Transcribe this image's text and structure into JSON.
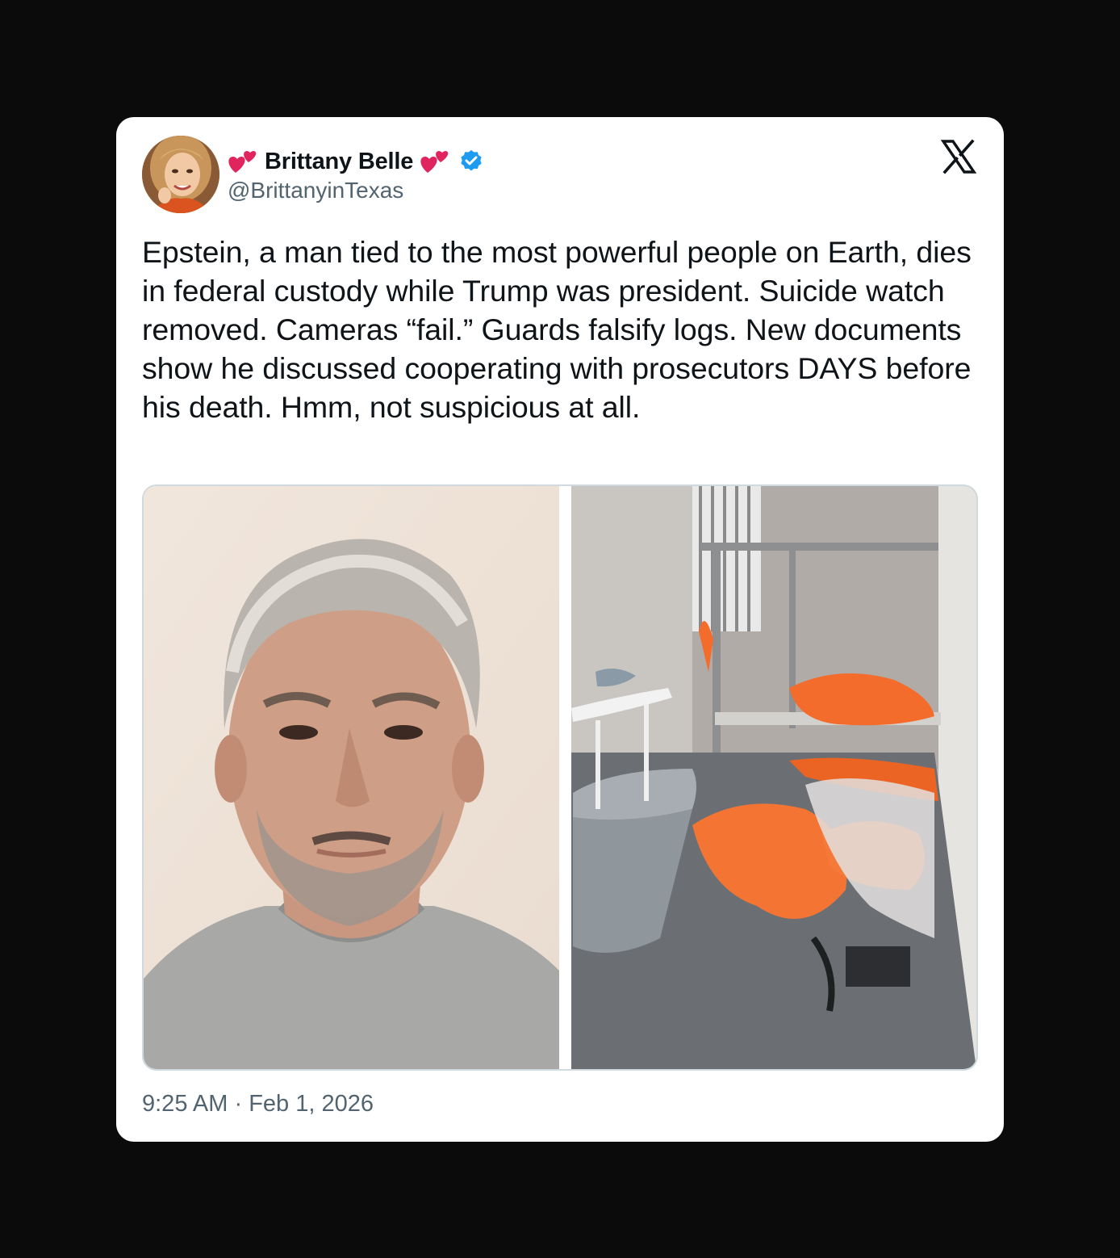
{
  "author": {
    "display_name": "Brittany Belle",
    "handle": "@BrittanyinTexas",
    "verified": true,
    "name_emoji": "two-hearts-icon"
  },
  "platform_icon": "x-logo-icon",
  "tweet": {
    "text": "Epstein, a man tied to the most powerful people on Earth, dies in federal custody while Trump was president. Suicide watch removed. Cameras “fail.” Guards falsify logs. New documents show he discussed cooperating with prosecutors DAYS before his death. Hmm, not suspicious at all.",
    "time": "9:25 AM",
    "separator": "·",
    "date": "Feb 1, 2026"
  },
  "media": {
    "images": [
      "man-portrait-photo",
      "jail-cell-photo"
    ]
  },
  "colors": {
    "background": "#0b0b0b",
    "card": "#ffffff",
    "text_primary": "#0f1419",
    "text_secondary": "#536471",
    "verified_blue": "#1d9bf0",
    "heart_red": "#e0245e"
  }
}
